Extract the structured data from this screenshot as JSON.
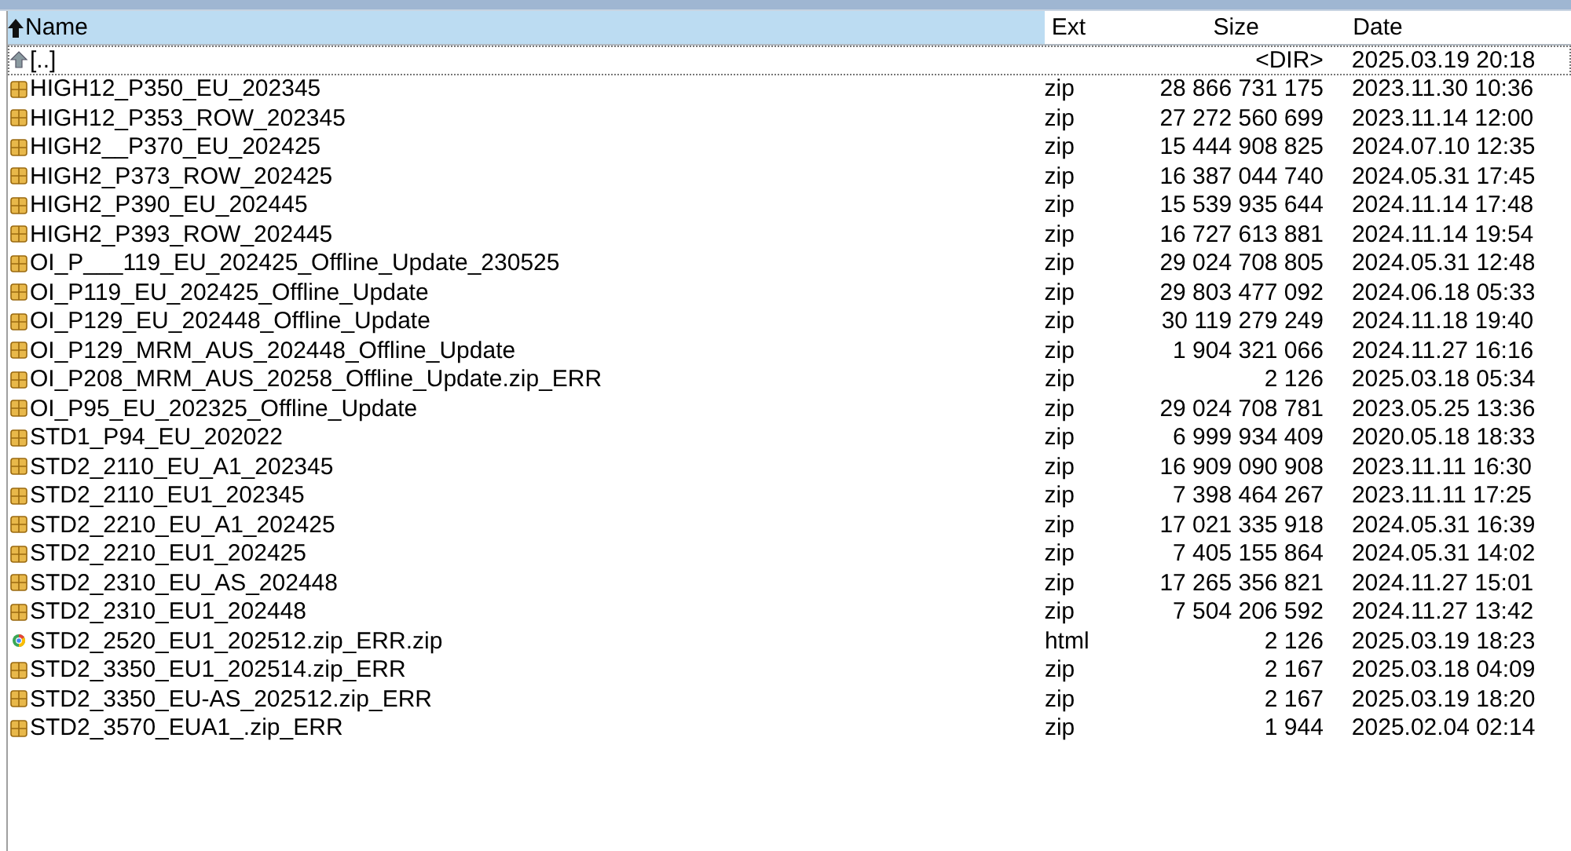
{
  "columns": [
    {
      "label": "Name",
      "sorted": true
    },
    {
      "label": "Ext",
      "sorted": false
    },
    {
      "label": "Size",
      "sorted": false
    },
    {
      "label": "Date",
      "sorted": false
    }
  ],
  "rows": [
    {
      "kind": "parent",
      "name": "[..]",
      "ext": "",
      "size": "<DIR>",
      "date": "2025.03.19 20:18",
      "focused": true
    },
    {
      "kind": "archive",
      "name": "HIGH12_P350_EU_202345",
      "ext": "zip",
      "size": "28 866 731 175",
      "date": "2023.11.30 10:36",
      "focused": false
    },
    {
      "kind": "archive",
      "name": "HIGH12_P353_ROW_202345",
      "ext": "zip",
      "size": "27 272 560 699",
      "date": "2023.11.14 12:00",
      "focused": false
    },
    {
      "kind": "archive",
      "name": "HIGH2__P370_EU_202425",
      "ext": "zip",
      "size": "15 444 908 825",
      "date": "2024.07.10 12:35",
      "focused": false
    },
    {
      "kind": "archive",
      "name": "HIGH2_P373_ROW_202425",
      "ext": "zip",
      "size": "16 387 044 740",
      "date": "2024.05.31 17:45",
      "focused": false
    },
    {
      "kind": "archive",
      "name": "HIGH2_P390_EU_202445",
      "ext": "zip",
      "size": "15 539 935 644",
      "date": "2024.11.14 17:48",
      "focused": false
    },
    {
      "kind": "archive",
      "name": "HIGH2_P393_ROW_202445",
      "ext": "zip",
      "size": "16 727 613 881",
      "date": "2024.11.14 19:54",
      "focused": false
    },
    {
      "kind": "archive",
      "name": "OI_P___119_EU_202425_Offline_Update_230525",
      "ext": "zip",
      "size": "29 024 708 805",
      "date": "2024.05.31 12:48",
      "focused": false
    },
    {
      "kind": "archive",
      "name": "OI_P119_EU_202425_Offline_Update",
      "ext": "zip",
      "size": "29 803 477 092",
      "date": "2024.06.18 05:33",
      "focused": false
    },
    {
      "kind": "archive",
      "name": "OI_P129_EU_202448_Offline_Update",
      "ext": "zip",
      "size": "30 119 279 249",
      "date": "2024.11.18 19:40",
      "focused": false
    },
    {
      "kind": "archive",
      "name": "OI_P129_MRM_AUS_202448_Offline_Update",
      "ext": "zip",
      "size": "1 904 321 066",
      "date": "2024.11.27 16:16",
      "focused": false
    },
    {
      "kind": "archive",
      "name": "OI_P208_MRM_AUS_20258_Offline_Update.zip_ERR",
      "ext": "zip",
      "size": "2 126",
      "date": "2025.03.18 05:34",
      "focused": false
    },
    {
      "kind": "archive",
      "name": "OI_P95_EU_202325_Offline_Update",
      "ext": "zip",
      "size": "29 024 708 781",
      "date": "2023.05.25 13:36",
      "focused": false
    },
    {
      "kind": "archive",
      "name": "STD1_P94_EU_202022",
      "ext": "zip",
      "size": "6 999 934 409",
      "date": "2020.05.18 18:33",
      "focused": false
    },
    {
      "kind": "archive",
      "name": "STD2_2110_EU_A1_202345",
      "ext": "zip",
      "size": "16 909 090 908",
      "date": "2023.11.11 16:30",
      "focused": false
    },
    {
      "kind": "archive",
      "name": "STD2_2110_EU1_202345",
      "ext": "zip",
      "size": "7 398 464 267",
      "date": "2023.11.11 17:25",
      "focused": false
    },
    {
      "kind": "archive",
      "name": "STD2_2210_EU_A1_202425",
      "ext": "zip",
      "size": "17 021 335 918",
      "date": "2024.05.31 16:39",
      "focused": false
    },
    {
      "kind": "archive",
      "name": "STD2_2210_EU1_202425",
      "ext": "zip",
      "size": "7 405 155 864",
      "date": "2024.05.31 14:02",
      "focused": false
    },
    {
      "kind": "archive",
      "name": "STD2_2310_EU_AS_202448",
      "ext": "zip",
      "size": "17 265 356 821",
      "date": "2024.11.27 15:01",
      "focused": false
    },
    {
      "kind": "archive",
      "name": "STD2_2310_EU1_202448",
      "ext": "zip",
      "size": "7 504 206 592",
      "date": "2024.11.27 13:42",
      "focused": false
    },
    {
      "kind": "web",
      "name": "STD2_2520_EU1_202512.zip_ERR.zip",
      "ext": "html",
      "size": "2 126",
      "date": "2025.03.19 18:23",
      "focused": false
    },
    {
      "kind": "archive",
      "name": "STD2_3350_EU1_202514.zip_ERR",
      "ext": "zip",
      "size": "2 167",
      "date": "2025.03.18 04:09",
      "focused": false
    },
    {
      "kind": "archive",
      "name": "STD2_3350_EU-AS_202512.zip_ERR",
      "ext": "zip",
      "size": "2 167",
      "date": "2025.03.19 18:20",
      "focused": false
    },
    {
      "kind": "archive",
      "name": "STD2_3570_EUA1_.zip_ERR",
      "ext": "zip",
      "size": "1 944",
      "date": "2025.02.04 02:14",
      "focused": false
    }
  ]
}
